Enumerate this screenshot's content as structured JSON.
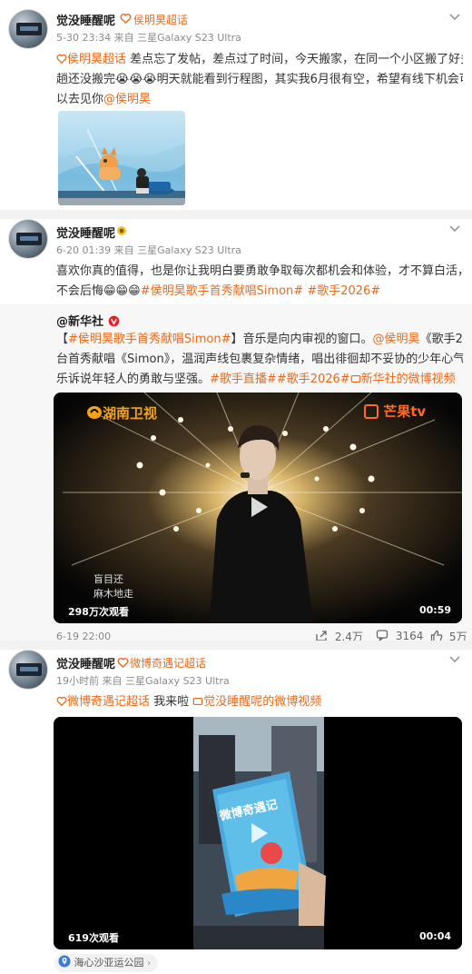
{
  "post1": {
    "username": "觉没睡醒呢",
    "tag": "侯明昊超话",
    "meta": "5-30 23:34  来自  三星Galaxy S23 Ultra",
    "text": {
      "tag": "侯明昊超话",
      "line1_rest": " 差点忘了发帖，差点过了时间，今天搬家，在同一个小区搬了好多",
      "line2": "趟还没搬完😭😭😭明天就能看到行程图，其实我6月很有空，希望有线下机会可",
      "line3_pre": "以去见你",
      "mention": "@侯明昊"
    }
  },
  "post2": {
    "username": "觉没睡醒呢",
    "meta": "6-20 01:39  来自  三星Galaxy S23 Ultra",
    "text": {
      "line1": "喜欢你真的值得，也是你让我明白要勇敢争取每次都机会和体验，才不算白活，才",
      "line2_pre": "不会后悔😁😁😁",
      "topic1": "#侯明昊歌手首秀献唱Simon#",
      "topic2": " #歌手2026#"
    },
    "repost": {
      "author": "@新华社",
      "line1_pre": "【",
      "line1_topic": "#侯明昊歌手首秀献唱Simon#",
      "line1_rest": "】音乐是向内审视的窗口。",
      "line1_mention": "@侯明昊",
      "line1_tail": "《歌手2026》舞",
      "line2": "台首秀献唱《Simon》，温润声线包裹复杂情绪，唱出徘徊却不妥协的少年心气，用音",
      "line3_pre": "乐诉说年轻人的勇敢与坚强。",
      "line3_topics": "#歌手直播##歌手2026#",
      "line3_link": "新华社的微博视频",
      "video": {
        "logo_left": "湖南卫视",
        "logo_right": "芒果tv",
        "subtitle1": "盲目还",
        "subtitle2": "麻木地走",
        "views": "298万次观看",
        "duration": "00:59"
      },
      "time": "6-19 22:00",
      "shares": "2.4万",
      "comments": "3164",
      "likes": "5万"
    }
  },
  "post3": {
    "username": "觉没睡醒呢",
    "tag": "微博奇遇记超话",
    "meta": "19小时前  来自  三星Galaxy S23 Ultra",
    "text": {
      "tag": "微博奇遇记超话",
      "rest": " 我来啦 ",
      "link": "觉没睡醒呢的微博视频"
    },
    "video": {
      "poster_title": "微博奇遇记",
      "views": "619次观看",
      "duration": "00:04"
    },
    "location": "海心沙亚运公园"
  },
  "colors": {
    "accent": "#e86b1c",
    "link": "#e86b1c",
    "verified": "#e0242b",
    "location_icon": "#3a7bd5"
  }
}
